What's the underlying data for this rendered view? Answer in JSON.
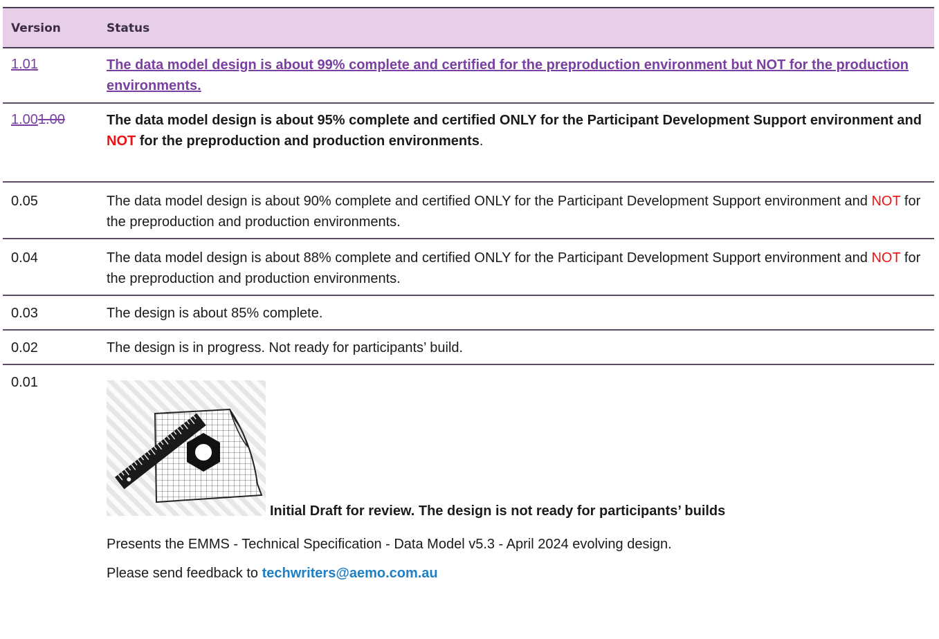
{
  "header": {
    "col_version": "Version",
    "col_status": "Status"
  },
  "rows": [
    {
      "version": "1.01",
      "status": "The data model design is about 99% complete and certified for the preproduction environment but NOT for the production environments."
    },
    {
      "version_new": "1.00",
      "version_old": "1.00",
      "status_a": "The data model design is about 95% complete and certified ONLY for the Participant Development Support environment and ",
      "status_not": "NOT",
      "status_b": " for the preproduction and production environments",
      "status_end": "."
    },
    {
      "version": "0.05",
      "status_a": "The data model design is about 90% complete and certified ONLY for the Participant Development Support environment and ",
      "status_not": "NOT",
      "status_b": " for the preproduction and production environments."
    },
    {
      "version": "0.04",
      "status_a": "The data model design is about 88% complete and certified ONLY for the Participant Development Support environment and ",
      "status_not": "NOT",
      "status_b": " for the preproduction and production environments."
    },
    {
      "version": "0.03",
      "status": "The design is about 85% complete."
    },
    {
      "version": "0.02",
      "status": "The design is in progress. Not ready for participants’ build."
    },
    {
      "version": "0.01",
      "draft": "Initial Draft for review. The design is not ready for participants’ builds",
      "presents": "Presents the EMMS - Technical Specification - Data Model v5.3 - April 2024 evolving design.",
      "feedback": "Please send feedback to ",
      "email": "techwriters@aemo.com.au"
    }
  ],
  "colors": {
    "header_bg": "#e7cfe9",
    "tracked_change": "#7a3fa0",
    "not_red": "#ee1111",
    "link": "#1f7fc4"
  },
  "icons": [
    "design-illustration-icon"
  ]
}
